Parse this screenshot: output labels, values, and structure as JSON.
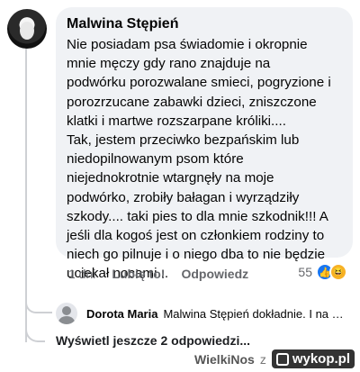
{
  "comment": {
    "author": "Malwina Stępień",
    "text": "Nie posiadam psa świadomie i okropnie\nmnie męczy gdy rano znajduje na\npodwórku porozwalane smieci, pogryzione i\nporozrzucane zabawki dzieci, zniszczone\nklatki i martwe rozszarpane króliki....\nTak, jestem przeciwko bezpańskim lub\nniedopilnowanym psom które\nniejednokrotnie wtargnęły na moje\npodwórko, zrobiły bałagan i wyrządziły\nszkody.... taki pies to dla mnie szkodnik!!! A\njeśli dla kogoś jest on członkiem rodziny to\nniech go pilnuje i o niego dba to nie będzie\nuciekał nocami...",
    "time": "1 dni",
    "like_label": "Lubię to!",
    "reply_label": "Odpowiedz",
    "reaction_count": "55",
    "reaction_icons": [
      "like-icon",
      "haha-icon"
    ]
  },
  "reply": {
    "author": "Dorota Maria",
    "text": "Malwina Stępień dokładnie. I na dod..."
  },
  "more_replies_label": "Wyświetl jeszcze 2 odpowiedzi...",
  "watermark": {
    "user": "WielkiNos",
    "separator": "z",
    "site": "wykop.pl"
  },
  "colors": {
    "bubble": "#f0f2f5",
    "like": "#1877f2",
    "haha": "#f7b125",
    "muted": "#65676b"
  }
}
